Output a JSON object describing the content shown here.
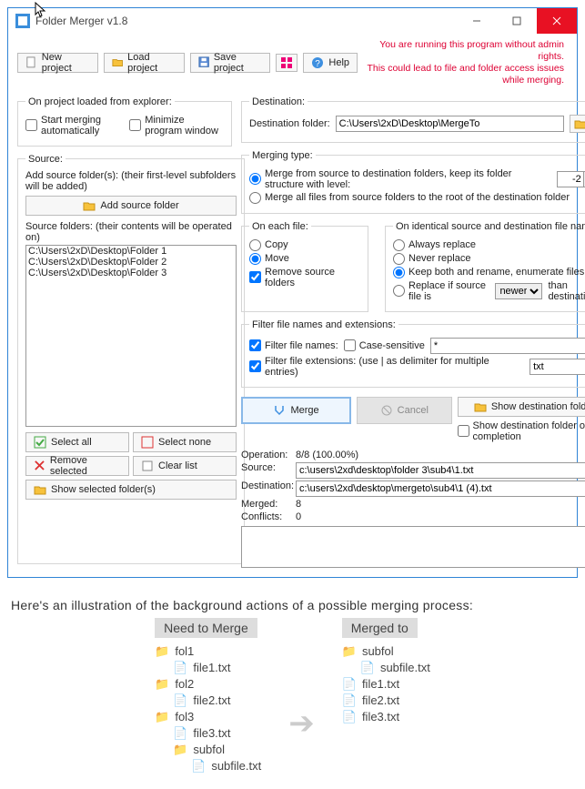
{
  "window": {
    "title": "Folder Merger v1.8"
  },
  "warning": {
    "line1": "You are running this program without admin rights.",
    "line2": "This could lead to file and folder access issues while merging."
  },
  "toolbar": {
    "new_project": "New project",
    "load_project": "Load project",
    "save_project": "Save project",
    "help": "Help"
  },
  "on_project_loaded": {
    "legend": "On project loaded from explorer:",
    "start_auto": "Start merging automatically",
    "minimize": "Minimize program window"
  },
  "source": {
    "legend": "Source:",
    "add_hint": "Add source folder(s): (their first-level subfolders will be added)",
    "add_btn": "Add source folder",
    "list_label": "Source folders: (their contents will be operated on)",
    "folders": [
      "C:\\Users\\2xD\\Desktop\\Folder 1",
      "C:\\Users\\2xD\\Desktop\\Folder 2",
      "C:\\Users\\2xD\\Desktop\\Folder 3"
    ],
    "buttons": {
      "select_all": "Select all",
      "select_none": "Select none",
      "remove_selected": "Remove selected",
      "clear_list": "Clear list",
      "show_selected": "Show selected folder(s)"
    }
  },
  "destination": {
    "legend": "Destination:",
    "label": "Destination folder:",
    "value": "C:\\Users\\2xD\\Desktop\\MergeTo"
  },
  "merging_type": {
    "legend": "Merging type:",
    "keep_structure": "Merge from source to destination folders, keep its folder structure with level:",
    "level": "-2",
    "flat": "Merge all files from source folders to the root of the destination folder"
  },
  "each_file": {
    "legend": "On each file:",
    "copy": "Copy",
    "move": "Move",
    "remove_src": "Remove source folders"
  },
  "identical": {
    "legend": "On identical source and destination file names:",
    "always": "Always replace",
    "never": "Never replace",
    "keep_rename": "Keep both and rename, enumerate files",
    "replace_if": "Replace if source file is",
    "newer": "newer",
    "than_dest": "than destination file"
  },
  "filter": {
    "legend": "Filter file names and extensions:",
    "names_label": "Filter file names:",
    "case_sensitive": "Case-sensitive",
    "names_value": "*",
    "ext_label": "Filter file extensions: (use | as delimiter for multiple entries)",
    "ext_value": "txt"
  },
  "actions": {
    "merge": "Merge",
    "cancel": "Cancel",
    "show_dest": "Show destination folder",
    "show_on_complete": "Show destination folder on completion"
  },
  "status": {
    "operation_label": "Operation:",
    "operation": "8/8 (100.00%)",
    "source_label": "Source:",
    "source": "c:\\users\\2xd\\desktop\\folder 3\\sub4\\1.txt",
    "destination_label": "Destination:",
    "destination": "c:\\users\\2xd\\desktop\\mergeto\\sub4\\1 (4).txt",
    "merged_label": "Merged:",
    "merged": "8",
    "conflicts_label": "Conflicts:",
    "conflicts": "0"
  },
  "illustration": {
    "caption": "Here's an illustration of the background actions of a possible merging process:",
    "need_head": "Need to Merge",
    "merged_head": "Merged to",
    "left": {
      "fol1": "fol1",
      "file1": "file1.txt",
      "fol2": "fol2",
      "file2": "file2.txt",
      "fol3": "fol3",
      "file3": "file3.txt",
      "subfol": "subfol",
      "subfile": "subfile.txt"
    },
    "right": {
      "subfol": "subfol",
      "subfile": "subfile.txt",
      "file1": "file1.txt",
      "file2": "file2.txt",
      "file3": "file3.txt"
    }
  }
}
